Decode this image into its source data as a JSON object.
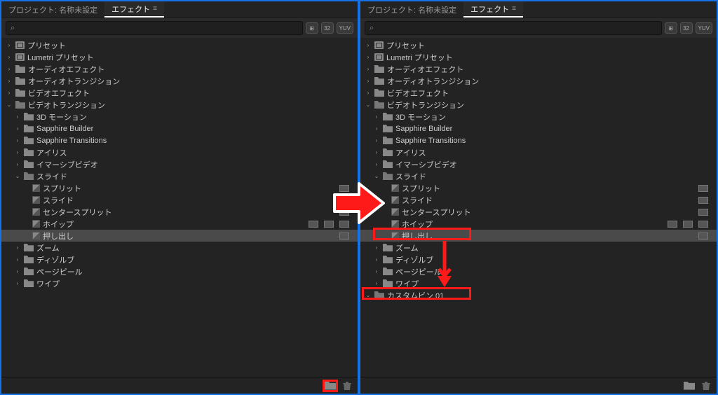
{
  "tabs": {
    "project": "プロジェクト: 名称未設定",
    "effects": "エフェクト"
  },
  "filters": {
    "b1": "⊞",
    "b2": "32",
    "b3": "YUV"
  },
  "tree": {
    "presets": "プリセット",
    "lumetri": "Lumetri プリセット",
    "audioFx": "オーディオエフェクト",
    "audioTr": "オーディオトランジション",
    "videoFx": "ビデオエフェクト",
    "videoTr": "ビデオトランジション",
    "threeD": "3D モーション",
    "sb": "Sapphire Builder",
    "st": "Sapphire Transitions",
    "iris": "アイリス",
    "immersive": "イマーシブビデオ",
    "slide": "スライド",
    "split": "スプリット",
    "slideFx": "スライド",
    "center": "センタースプリット",
    "whip": "ホイップ",
    "push": "押し出し",
    "zoom": "ズーム",
    "dissolve": "ディゾルブ",
    "pagepeel": "ページピール",
    "wipe": "ワイプ",
    "custom": "カスタムビン 01"
  }
}
